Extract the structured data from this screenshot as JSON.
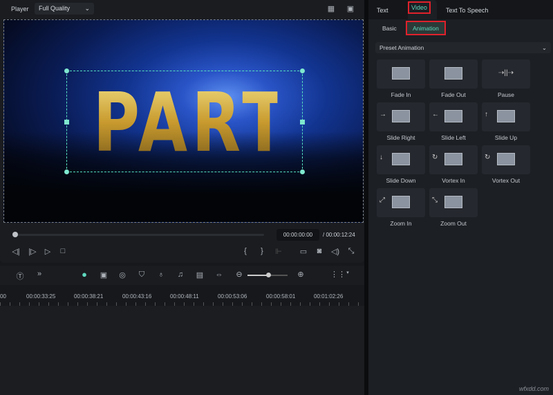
{
  "player": {
    "label": "Player",
    "quality": "Full Quality",
    "overlay_text": "PARTY!",
    "current_time": "00:00:00:00",
    "total_time": "/ 00:00:12:24"
  },
  "timeline": {
    "ruler": [
      "00",
      "00:00:33:25",
      "00:00:38:21",
      "00:00:43:16",
      "00:00:48:11",
      "00:00:53:06",
      "00:00:58:01",
      "00:01:02:26"
    ]
  },
  "panel": {
    "tabs": [
      "Text",
      "Video",
      "Text To Speech"
    ],
    "active_tab": "Video",
    "subtabs": [
      "Basic",
      "Animation"
    ],
    "active_subtab": "Animation",
    "dropdown": "Preset Animation",
    "presets": [
      "Fade In",
      "Fade Out",
      "Pause",
      "Slide Right",
      "Slide Left",
      "Slide Up",
      "Slide Down",
      "Vortex In",
      "Vortex Out",
      "Zoom In",
      "Zoom Out"
    ]
  },
  "colors": {
    "accent": "#5fd9bf",
    "highlight": "#e0212b"
  },
  "watermark": "wfxdd.com"
}
